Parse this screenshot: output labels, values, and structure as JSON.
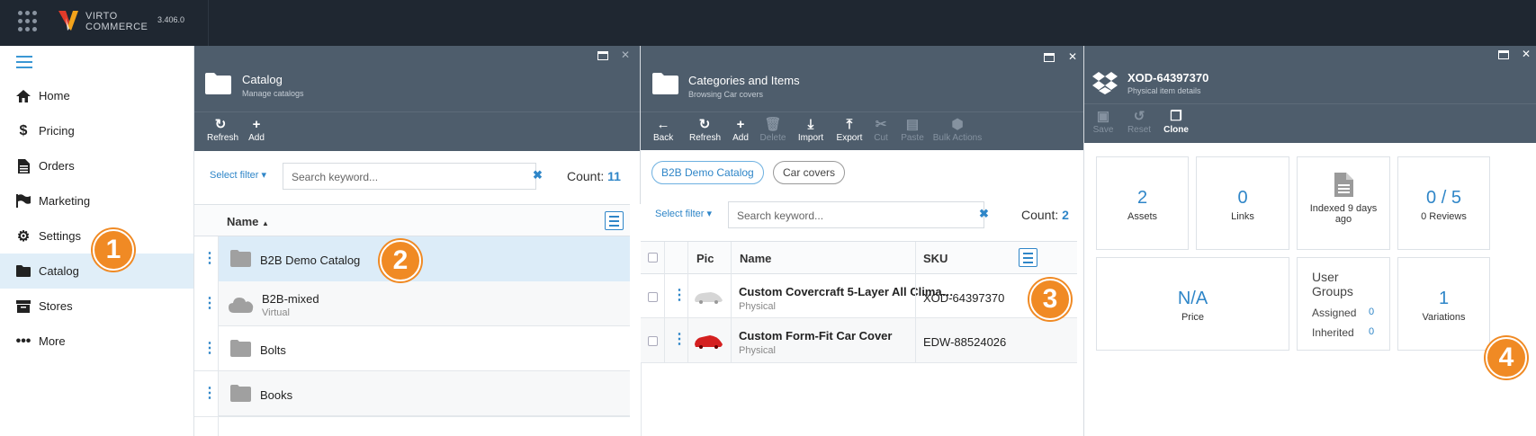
{
  "topbar": {
    "logo_line1": "VIRTO",
    "logo_line2": "COMMERCE",
    "version": "3.406.0"
  },
  "sidebar": {
    "items": [
      {
        "label": "Home",
        "icon": "home-icon"
      },
      {
        "label": "Pricing",
        "icon": "dollar-icon"
      },
      {
        "label": "Orders",
        "icon": "document-icon"
      },
      {
        "label": "Marketing",
        "icon": "flag-icon"
      },
      {
        "label": "Settings",
        "icon": "gears-icon"
      },
      {
        "label": "Catalog",
        "icon": "folder-icon"
      },
      {
        "label": "Stores",
        "icon": "archive-icon"
      },
      {
        "label": "More",
        "icon": "ellipsis-icon"
      }
    ]
  },
  "badges": [
    "1",
    "2",
    "3",
    "4"
  ],
  "catalog_blade": {
    "title": "Catalog",
    "subtitle": "Manage catalogs",
    "toolbar": [
      {
        "label": "Refresh",
        "icon": "refresh-icon"
      },
      {
        "label": "Add",
        "icon": "plus-icon"
      }
    ],
    "filter_label": "Select filter ▾",
    "search_placeholder": "Search keyword...",
    "count_label": "Count:",
    "count": "11",
    "column_name": "Name",
    "sort_indicator": "▲",
    "rows": [
      {
        "name": "B2B Demo Catalog",
        "sub": "",
        "icon": "folder-icon"
      },
      {
        "name": "B2B-mixed",
        "sub": "Virtual",
        "icon": "cloud-icon"
      },
      {
        "name": "Bolts",
        "sub": "",
        "icon": "folder-icon"
      },
      {
        "name": "Books",
        "sub": "",
        "icon": "folder-icon"
      }
    ]
  },
  "categories_blade": {
    "title": "Categories and Items",
    "subtitle": "Browsing Car covers",
    "toolbar": [
      {
        "label": "Back",
        "icon": "arrow-left-icon",
        "disabled": false
      },
      {
        "label": "Refresh",
        "icon": "refresh-icon",
        "disabled": false
      },
      {
        "label": "Add",
        "icon": "plus-icon",
        "disabled": false
      },
      {
        "label": "Delete",
        "icon": "trash-icon",
        "disabled": true
      },
      {
        "label": "Import",
        "icon": "download-icon",
        "disabled": false
      },
      {
        "label": "Export",
        "icon": "upload-icon",
        "disabled": false
      },
      {
        "label": "Cut",
        "icon": "scissors-icon",
        "disabled": true
      },
      {
        "label": "Paste",
        "icon": "paste-icon",
        "disabled": true
      },
      {
        "label": "Bulk Actions",
        "icon": "cubes-icon",
        "disabled": true
      }
    ],
    "breadcrumbs": [
      "B2B Demo Catalog",
      "Car covers"
    ],
    "filter_label": "Select filter ▾",
    "search_placeholder": "Search keyword...",
    "count_label": "Count:",
    "count": "2",
    "columns": {
      "pic": "Pic",
      "name": "Name",
      "sku": "SKU"
    },
    "rows": [
      {
        "name": "Custom Covercraft 5-Layer All Clima…",
        "type": "Physical",
        "sku": "XOD-64397370"
      },
      {
        "name": "Custom Form-Fit Car Cover",
        "type": "Physical",
        "sku": "EDW-88524026"
      }
    ]
  },
  "item_blade": {
    "title": "XOD-64397370",
    "subtitle": "Physical item details",
    "toolbar": [
      {
        "label": "Save",
        "icon": "save-icon",
        "disabled": true
      },
      {
        "label": "Reset",
        "icon": "undo-icon",
        "disabled": true
      },
      {
        "label": "Clone",
        "icon": "clone-icon",
        "disabled": false
      }
    ],
    "tiles": {
      "assets": {
        "value": "2",
        "label": "Assets"
      },
      "links": {
        "value": "0",
        "label": "Links"
      },
      "indexed": {
        "label": "Indexed 9 days ago"
      },
      "reviews": {
        "value": "0 / 5",
        "label": "0 Reviews"
      },
      "price": {
        "value": "N/A",
        "label": "Price"
      },
      "user_groups": {
        "title": "User Groups",
        "assigned_label": "Assigned",
        "assigned": "0",
        "inherited_label": "Inherited",
        "inherited": "0"
      },
      "variations": {
        "value": "1",
        "label": "Variations"
      }
    }
  },
  "colors": {
    "accent": "#2f86c8",
    "header": "#4e5d6c",
    "topbar": "#1f2731",
    "badge": "#f08a24"
  }
}
